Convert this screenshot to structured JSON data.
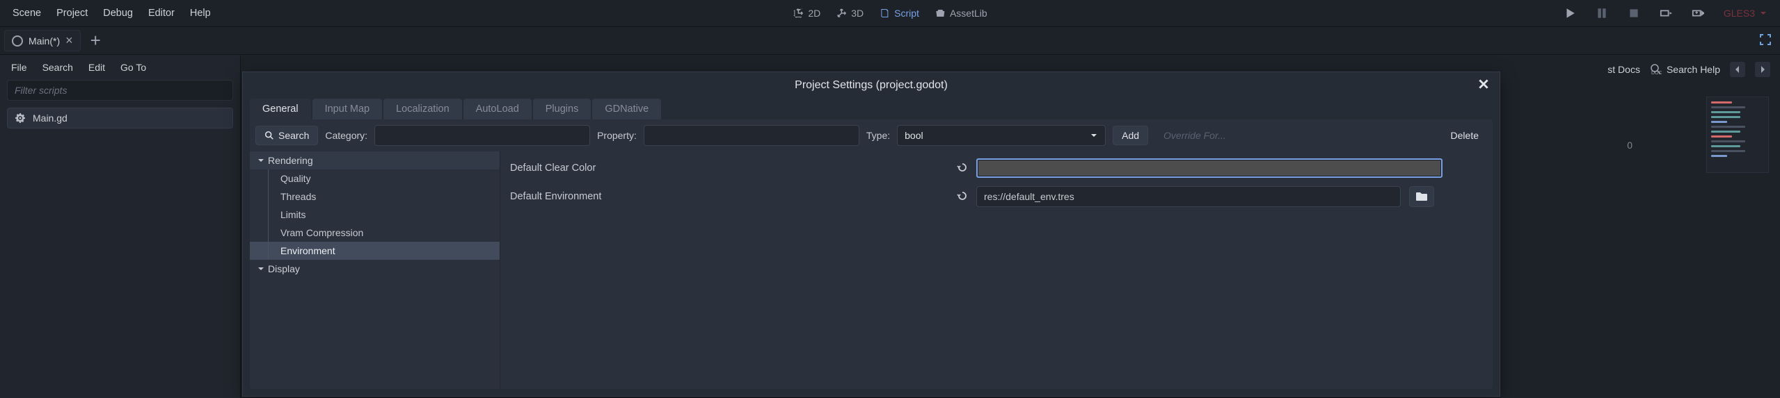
{
  "menu": {
    "items": [
      "Scene",
      "Project",
      "Debug",
      "Editor",
      "Help"
    ]
  },
  "views": {
    "v2d": "2D",
    "v3d": "3D",
    "script": "Script",
    "assetlib": "AssetLib"
  },
  "renderer": "GLES3",
  "doc_tab": {
    "title": "Main(*)"
  },
  "left": {
    "menu": [
      "File",
      "Search",
      "Edit",
      "Go To"
    ],
    "filter_placeholder": "Filter scripts",
    "script": "Main.gd"
  },
  "right_tools": {
    "online_docs": "Online Docs",
    "request_docs": "st Docs",
    "search_help": "Search Help"
  },
  "margin_number": "0",
  "dialog": {
    "title": "Project Settings (project.godot)",
    "tabs": [
      "General",
      "Input Map",
      "Localization",
      "AutoLoad",
      "Plugins",
      "GDNative"
    ],
    "toolbar": {
      "search": "Search",
      "category": "Category:",
      "property": "Property:",
      "type": "Type:",
      "type_value": "bool",
      "add": "Add",
      "override": "Override For...",
      "delete": "Delete"
    },
    "tree": {
      "rendering": "Rendering",
      "rendering_items": [
        "Quality",
        "Threads",
        "Limits",
        "Vram Compression",
        "Environment"
      ],
      "display": "Display"
    },
    "props": {
      "clear_color": "Default Clear Color",
      "env": "Default Environment",
      "env_value": "res://default_env.tres"
    }
  }
}
